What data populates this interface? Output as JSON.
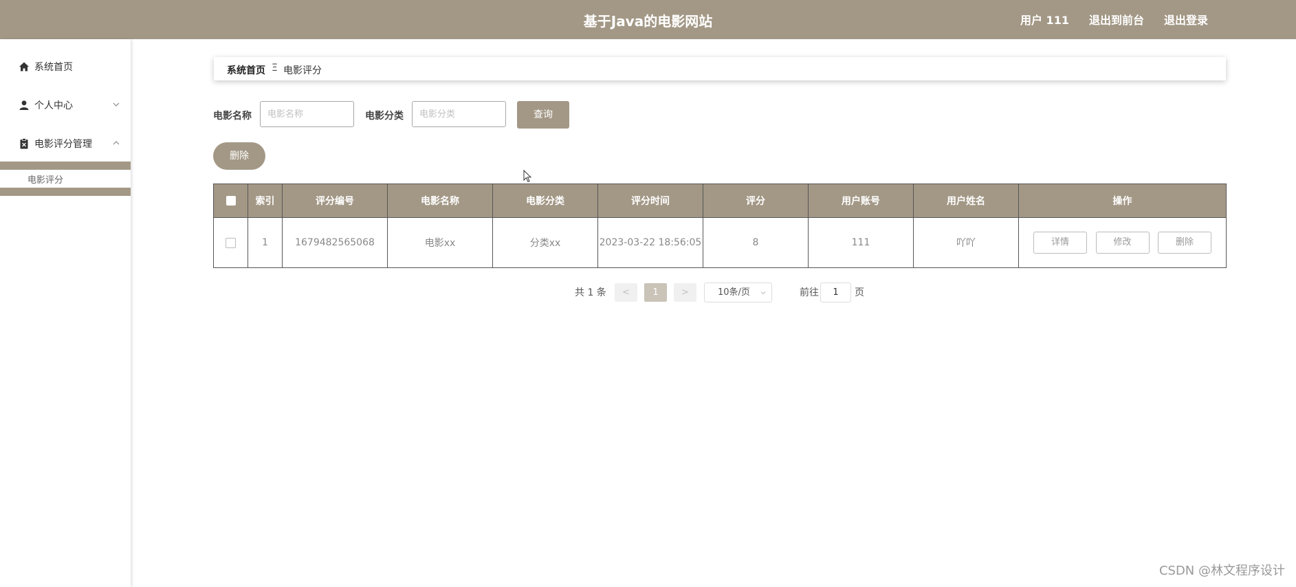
{
  "header": {
    "title": "基于Java的电影网站",
    "links": [
      "用户 111",
      "退出到前台",
      "退出登录"
    ]
  },
  "sidebar": {
    "items": [
      {
        "label": "系统首页",
        "icon": "home-icon"
      },
      {
        "label": "个人中心",
        "icon": "user-icon"
      },
      {
        "label": "电影评分管理",
        "icon": "clipboard-icon"
      }
    ],
    "submenu": {
      "label": "电影评分"
    }
  },
  "breadcrumb": {
    "home": "系统首页",
    "separator": "Ξ",
    "current": "电影评分"
  },
  "search": {
    "name_label": "电影名称",
    "name_placeholder": "电影名称",
    "category_label": "电影分类",
    "category_placeholder": "电影分类",
    "query_button": "查询"
  },
  "toolbar": {
    "delete_button": "删除"
  },
  "table": {
    "headers": [
      "索引",
      "评分编号",
      "电影名称",
      "电影分类",
      "评分时间",
      "评分",
      "用户账号",
      "用户姓名",
      "操作"
    ],
    "rows": [
      {
        "index": "1",
        "rating_no": "1679482565068",
        "movie_name": "电影xx",
        "movie_category": "分类xx",
        "rating_time": "2023-03-22 18:56:05",
        "score": "8",
        "user_account": "111",
        "user_name": "吖吖",
        "actions": [
          "详情",
          "修改",
          "删除"
        ]
      }
    ]
  },
  "pagination": {
    "total": "共 1 条",
    "prev": "<",
    "current_page": "1",
    "next": ">",
    "page_size": "10条/页",
    "goto_label": "前往",
    "goto_value": "1",
    "goto_suffix": "页"
  },
  "watermark": "CSDN @林文程序设计",
  "colors": {
    "accent": "#a39886",
    "header_text": "#ffffff"
  }
}
